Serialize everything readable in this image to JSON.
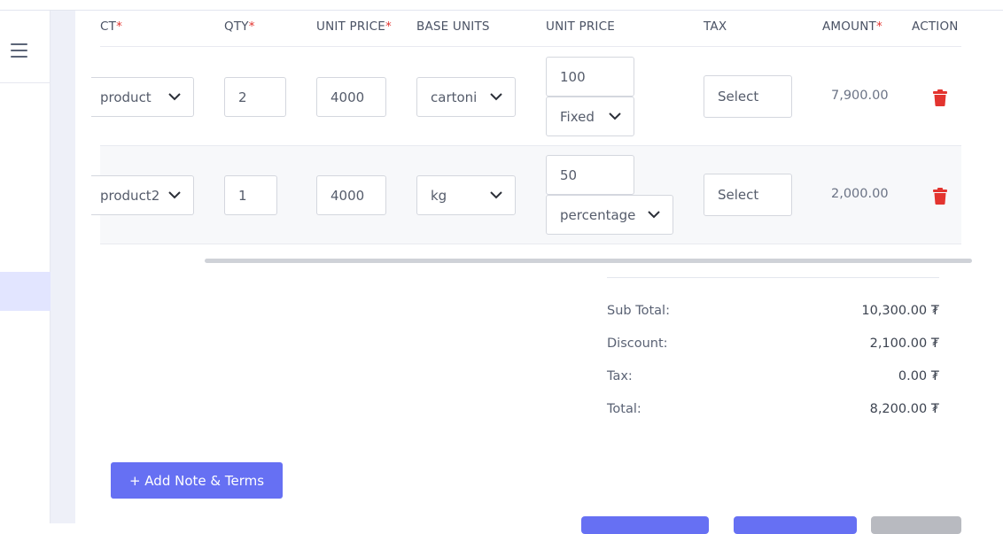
{
  "table": {
    "headers": [
      {
        "label": "CT",
        "required": "*"
      },
      {
        "label": "QTY",
        "required": "*"
      },
      {
        "label": "UNIT PRICE",
        "required": "*"
      },
      {
        "label": "BASE UNITS",
        "required": ""
      },
      {
        "label": "UNIT PRICE",
        "required": ""
      },
      {
        "label": "TAX",
        "required": ""
      },
      {
        "label": "AMOUNT",
        "required": "*"
      },
      {
        "label": "ACTION",
        "required": ""
      }
    ],
    "rows": [
      {
        "product": "product",
        "qty": "2",
        "unit_price": "4000",
        "base_unit": "cartoni",
        "discount_value": "100",
        "discount_type": "Fixed",
        "tax": "Select",
        "amount": "7,900.00"
      },
      {
        "product": "product2",
        "qty": "1",
        "unit_price": "4000",
        "base_unit": "kg",
        "discount_value": "50",
        "discount_type": "percentage",
        "tax": "Select",
        "amount": "2,000.00"
      }
    ]
  },
  "totals": {
    "subtotal_label": "Sub Total:",
    "subtotal_value": "10,300.00 ₮",
    "discount_label": "Discount:",
    "discount_value": "2,100.00 ₮",
    "tax_label": "Tax:",
    "tax_value": "0.00 ₮",
    "total_label": "Total:",
    "total_value": "8,200.00 ₮"
  },
  "buttons": {
    "add_note": "+ Add Note & Terms"
  },
  "colors": {
    "accent": "#6670f3",
    "danger": "#e3342f",
    "muted_button": "#b8bac0"
  },
  "icons": {
    "menu": "hamburger-icon",
    "chevron": "chevron-down-icon",
    "delete": "trash-icon"
  }
}
